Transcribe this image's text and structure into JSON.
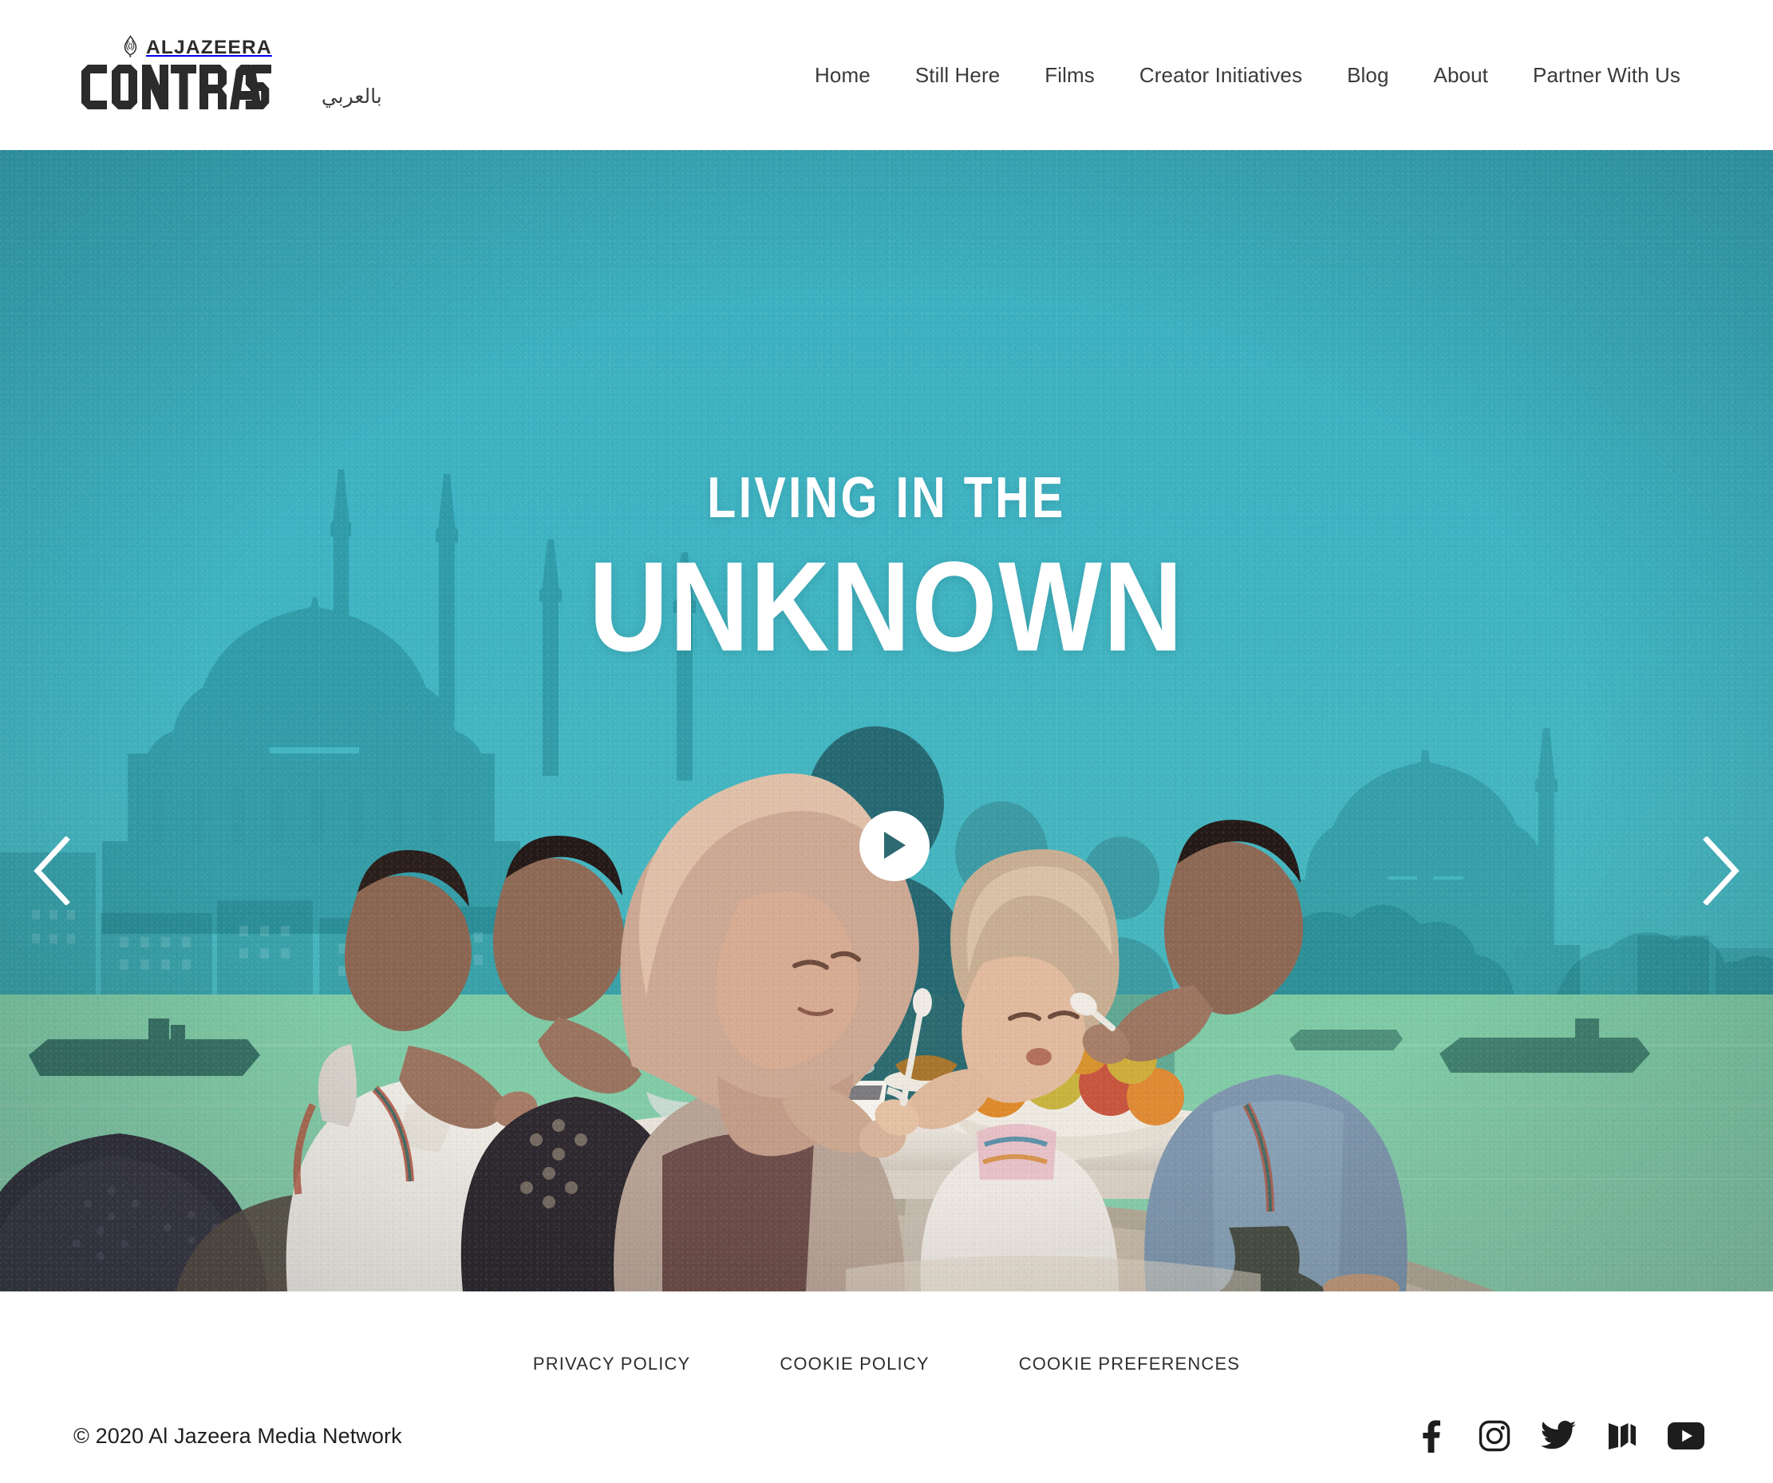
{
  "header": {
    "logo": {
      "network_name": "ALJAZEERA",
      "brand_name": "CONTRAST",
      "icon": "aljazeera-flame-icon"
    },
    "language_link": "بالعربي",
    "nav": [
      {
        "label": "Home"
      },
      {
        "label": "Still Here"
      },
      {
        "label": "Films"
      },
      {
        "label": "Creator Initiatives"
      },
      {
        "label": "Blog"
      },
      {
        "label": "About"
      },
      {
        "label": "Partner With Us"
      }
    ]
  },
  "hero": {
    "title_line1": "LIVING IN THE",
    "title_line2": "UNKNOWN",
    "play_label": "Play video",
    "prev_label": "Previous slide",
    "next_label": "Next slide",
    "colors": {
      "sky_teal": "#3fb3c2",
      "deep_teal": "#1f7f8c",
      "water_green": "#7ec9a4",
      "silhouette": "#2c6b73",
      "white": "#ffffff"
    },
    "scene_description": "Family eating at a low table with Istanbul skyline silhouette behind"
  },
  "footer": {
    "links": [
      {
        "label": "PRIVACY POLICY"
      },
      {
        "label": "COOKIE POLICY"
      },
      {
        "label": "COOKIE PREFERENCES"
      }
    ],
    "copyright": "© 2020 Al Jazeera Media Network",
    "social": [
      {
        "name": "facebook-icon",
        "label": "Facebook"
      },
      {
        "name": "instagram-icon",
        "label": "Instagram"
      },
      {
        "name": "twitter-icon",
        "label": "Twitter"
      },
      {
        "name": "medium-icon",
        "label": "Medium"
      },
      {
        "name": "youtube-icon",
        "label": "YouTube"
      }
    ]
  }
}
